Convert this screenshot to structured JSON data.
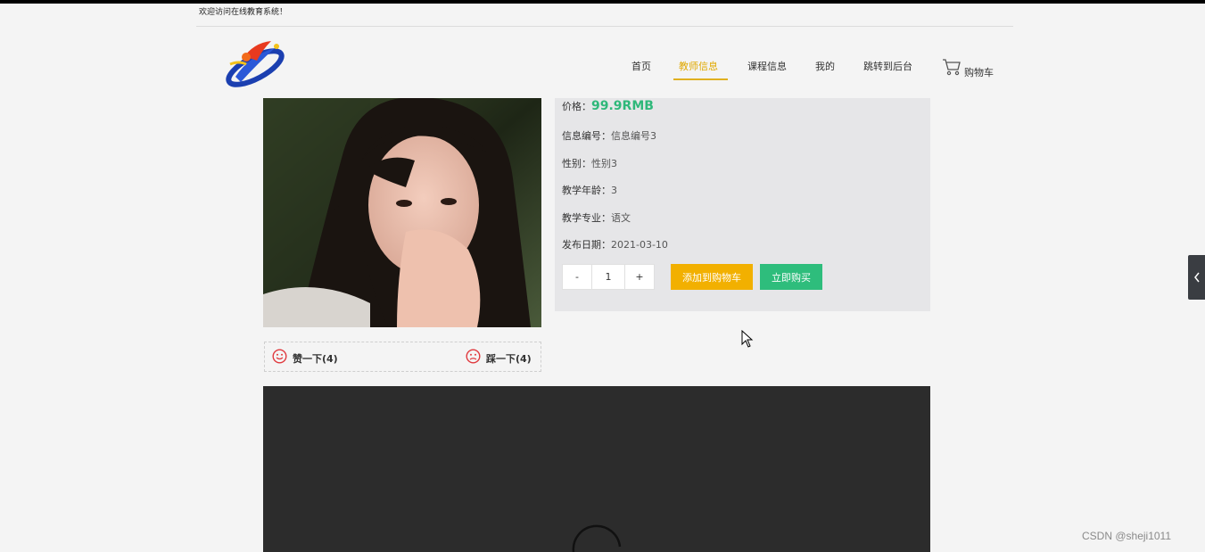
{
  "header": {
    "welcome": "欢迎访问在线教育系统！"
  },
  "nav": {
    "items": [
      {
        "label": "首页"
      },
      {
        "label": "教师信息"
      },
      {
        "label": "课程信息"
      },
      {
        "label": "我的"
      },
      {
        "label": "跳转到后台"
      }
    ],
    "active_index": 1,
    "cart_label": "购物车"
  },
  "votes": {
    "like": "赞一下(4)",
    "dislike": "踩一下(4)"
  },
  "detail": {
    "price_label": "价格：",
    "price_value": "99.9RMB",
    "fields": [
      {
        "key": "信息编号：",
        "value": "信息编号3"
      },
      {
        "key": "性别：",
        "value": "性别3"
      },
      {
        "key": "教学年龄：",
        "value": "3"
      },
      {
        "key": "教学专业：",
        "value": "语文"
      },
      {
        "key": "发布日期：",
        "value": "2021-03-10"
      }
    ],
    "quantity": {
      "minus": "-",
      "value": "1",
      "plus": "+"
    },
    "add_to_cart": "添加到购物车",
    "buy_now": "立即购买"
  },
  "colors": {
    "accent": "#e0a800",
    "price": "#2fb87a",
    "cart_button": "#f2b000",
    "buy_button": "#2ebd7c",
    "info_bg": "#e6e6e8",
    "video_bg": "#2c2c2c"
  },
  "icons": {
    "cart": "cart-icon",
    "like": "smile-icon",
    "dislike": "frown-icon",
    "side": "chevron-left-icon"
  },
  "watermark": "CSDN @sheji1011"
}
